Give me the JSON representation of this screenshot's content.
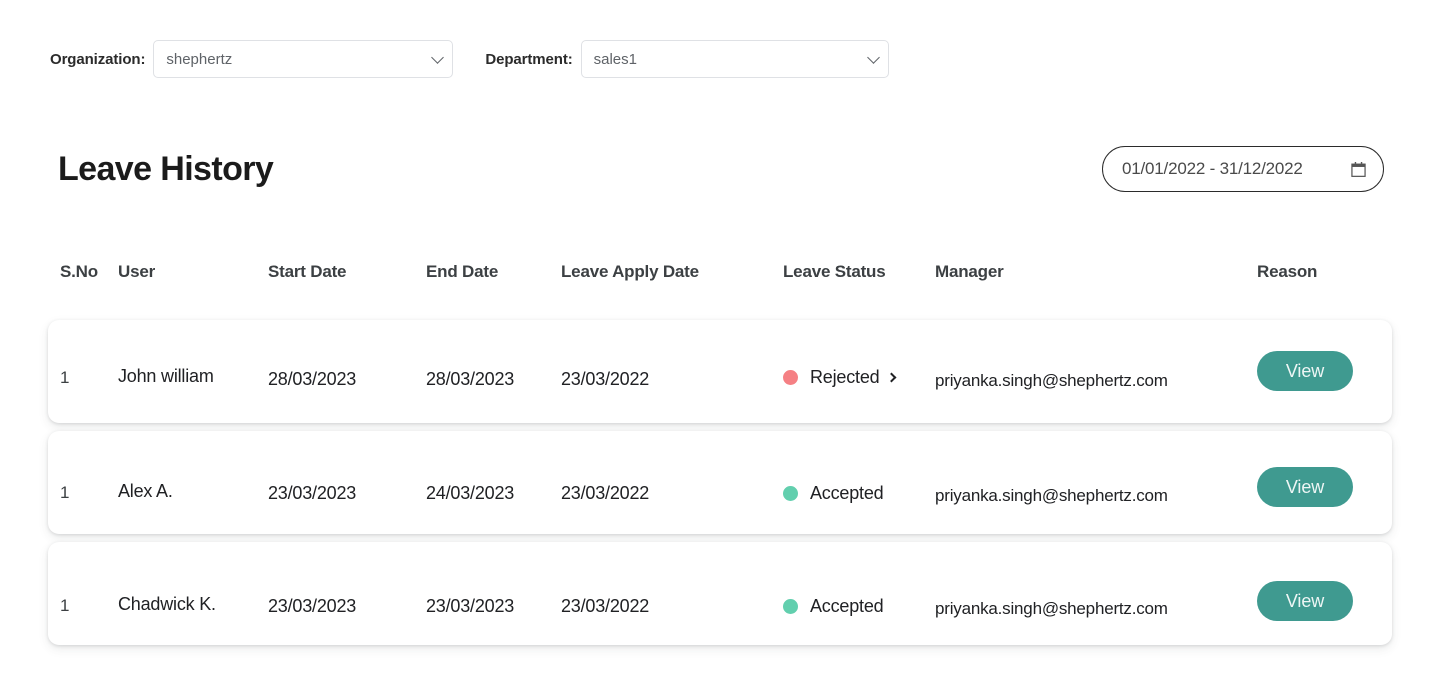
{
  "filters": {
    "organization": {
      "label": "Organization:",
      "value": "shephertz",
      "icon": "chevron-down-icon"
    },
    "department": {
      "label": "Department:",
      "value": "sales1",
      "icon": "chevron-down-icon"
    }
  },
  "header": {
    "title": "Leave History",
    "date_range": {
      "value": "01/01/2022 - 31/12/2022",
      "icon": "calendar-icon"
    }
  },
  "table": {
    "columns": [
      "S.No",
      "User",
      "Start Date",
      "End Date",
      "Leave Apply Date",
      "Leave Status",
      "Manager",
      "Reason"
    ],
    "rows": [
      {
        "sno": "1",
        "user": "John william",
        "start_date": "28/03/2023",
        "end_date": "28/03/2023",
        "apply_date": "23/03/2022",
        "status": "Rejected",
        "status_color": "#f58084",
        "has_chevron": true,
        "manager": "priyanka.singh@shephertz.com",
        "action_label": "View"
      },
      {
        "sno": "1",
        "user": "Alex A.",
        "start_date": "23/03/2023",
        "end_date": "24/03/2023",
        "apply_date": "23/03/2022",
        "status": "Accepted",
        "status_color": "#62cfae",
        "has_chevron": false,
        "manager": "priyanka.singh@shephertz.com",
        "action_label": "View"
      },
      {
        "sno": "1",
        "user": "Chadwick K.",
        "start_date": "23/03/2023",
        "end_date": "23/03/2023",
        "apply_date": "23/03/2022",
        "status": "Accepted",
        "status_color": "#62cfae",
        "has_chevron": false,
        "manager": "priyanka.singh@shephertz.com",
        "action_label": "View"
      }
    ]
  },
  "theme": {
    "accent": "#3f9a90",
    "accepted": "#62cfae",
    "rejected": "#f58084",
    "text": "#202124",
    "background": "#ffffff"
  }
}
